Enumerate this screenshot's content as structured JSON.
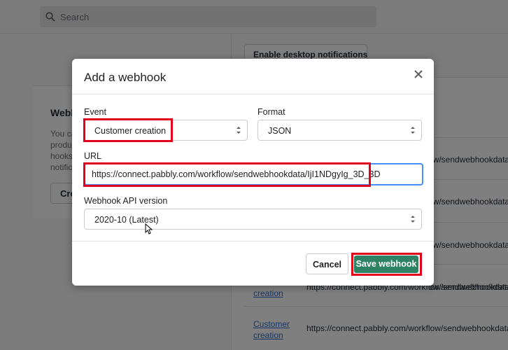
{
  "search": {
    "placeholder": "Search"
  },
  "background": {
    "section_title": "Webh",
    "section_desc": "You ca produ hooks notific",
    "create_label": "Cre",
    "desktop_notifications": "Enable desktop notifications",
    "rows": [
      {
        "url": "ow/sendwebhookdata"
      },
      {
        "url": "ow/sendwebhookdata"
      },
      {
        "url": "ow/sendwebhookdata"
      },
      {
        "url": "ow/sendwebhookdata"
      },
      {
        "event": "creation",
        "url": "https://connect.pabbly.com/workflow/sendwebhookdata"
      },
      {
        "event": "Customer creation",
        "url": "https://connect.pabbly.com/workflow/sendwebhookdata"
      }
    ]
  },
  "modal": {
    "title": "Add a webhook",
    "event_label": "Event",
    "event_value": "Customer creation",
    "format_label": "Format",
    "format_value": "JSON",
    "url_label": "URL",
    "url_value": "https://connect.pabbly.com/workflow/sendwebhookdata/IjI1NDgyIg_3D_3D",
    "version_label": "Webhook API version",
    "version_value": "2020-10 (Latest)",
    "cancel_label": "Cancel",
    "save_label": "Save webhook"
  },
  "colors": {
    "primary": "#2e8365",
    "highlight": "#e3001b",
    "focus": "#458fff",
    "link": "#2c6ecb"
  }
}
